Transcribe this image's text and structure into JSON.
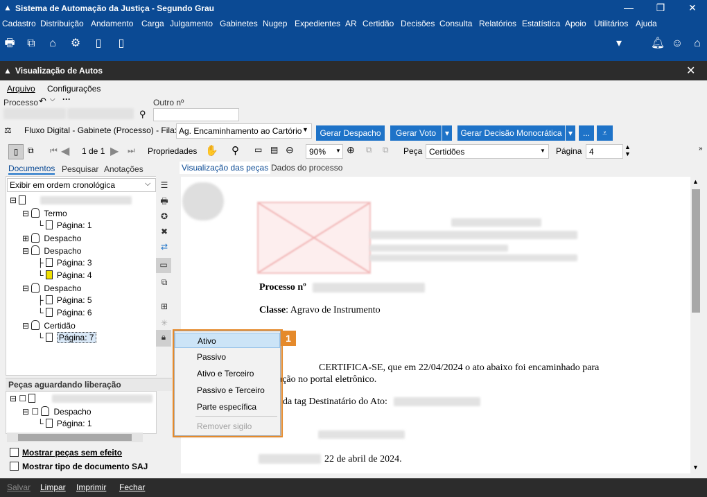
{
  "window": {
    "title": "Sistema de Automação da Justiça - Segundo Grau"
  },
  "menubar": [
    "Cadastro",
    "Distribuição",
    "Andamento",
    "Carga",
    "Julgamento",
    "Gabinetes",
    "Nugep",
    "Expedientes",
    "AR",
    "Certidão",
    "Decisões",
    "Consulta",
    "Relatórios",
    "Estatística",
    "Apoio",
    "Utilitários",
    "Ajuda"
  ],
  "subwindow": {
    "title": "Visualização de Autos"
  },
  "submenu": {
    "arquivo": "Arquivo",
    "configuracoes": "Configurações"
  },
  "process": {
    "processo_label": "Processo",
    "outro_label": "Outro nº"
  },
  "flow": {
    "label": "Fluxo Digital - Gabinete (Processo) - Fila:",
    "fila_value": "Ag. Encaminhamento ao Cartório",
    "btn_despacho": "Gerar Despacho",
    "btn_voto": "Gerar Voto",
    "btn_decisao": "Gerar Decisão Monocrática",
    "btn_more": "..."
  },
  "viewer_toolbar": {
    "page_info": "1 de 1",
    "properties": "Propriedades",
    "zoom": "90%",
    "peca_label": "Peça",
    "peca_value": "Certidões",
    "pagina_label": "Página",
    "pagina_value": "4"
  },
  "left_tabs": {
    "documentos": "Documentos",
    "pesquisar": "Pesquisar",
    "anotacoes": "Anotações"
  },
  "order_select": "Exibir em ordem cronológica",
  "tree": {
    "termo": "Termo",
    "termo_p1": "Página: 1",
    "despacho1": "Despacho",
    "despacho2": "Despacho",
    "despacho2_p3": "Página: 3",
    "despacho2_p4": "Página: 4",
    "despacho3": "Despacho",
    "despacho3_p5": "Página: 5",
    "despacho3_p6": "Página: 6",
    "certidao": "Certidão",
    "certidao_p7": "Página: 7"
  },
  "pending": {
    "title": "Peças aguardando liberação",
    "despacho": "Despacho",
    "p1": "Página: 1"
  },
  "options": {
    "sem_efeito": "Mostrar peças sem efeito",
    "tipo_doc": "Mostrar tipo de documento SAJ"
  },
  "right_tabs": {
    "pecas": "Visualização das peças",
    "dados": "Dados do processo"
  },
  "document": {
    "processo_label": "Processo nº",
    "classe_label": "Classe",
    "classe_value": ": Agravo de Instrumento",
    "certifica": "CERTIFICA-SE, que em 22/04/2024 o ato abaixo foi encaminhado para",
    "line2": "ação no portal eletrônico.",
    "line3": "da tag Destinatário do Ato:",
    "date_line": "22 de abril de 2024."
  },
  "context_menu": {
    "items": [
      "Ativo",
      "Passivo",
      "Ativo e Terceiro",
      "Passivo e Terceiro",
      "Parte específica",
      "Remover sigilo"
    ]
  },
  "callout_number": "1",
  "footer": {
    "salvar": "Salvar",
    "limpar": "Limpar",
    "imprimir": "Imprimir",
    "fechar": "Fechar"
  },
  "colors": {
    "brand": "#0b4a94",
    "accent": "#1e73c8",
    "callout": "#e58a2b"
  }
}
